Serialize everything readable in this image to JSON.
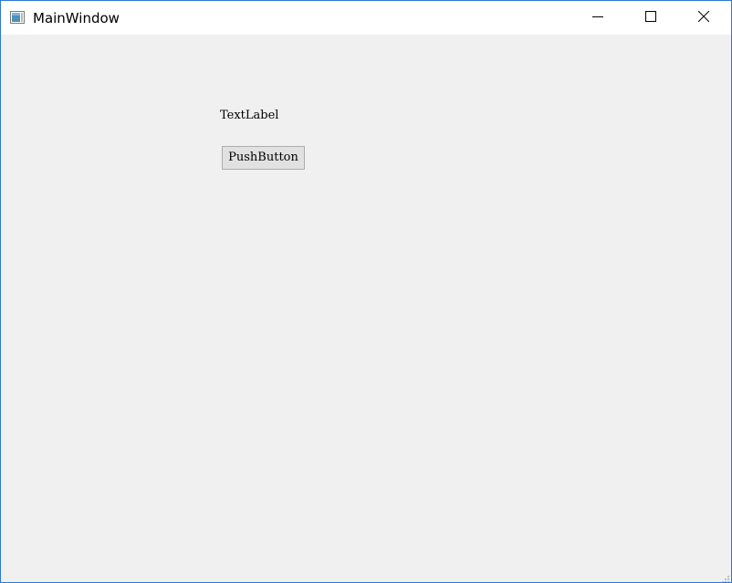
{
  "window": {
    "title": "MainWindow",
    "app_icon": "qt-window-icon",
    "controls": {
      "minimize_icon": "minimize-icon",
      "maximize_icon": "maximize-icon",
      "close_icon": "close-icon"
    },
    "border_color": "#2b78d0",
    "background_color": "#f0f0f0"
  },
  "content": {
    "label_text": "TextLabel",
    "button_label": "PushButton"
  }
}
